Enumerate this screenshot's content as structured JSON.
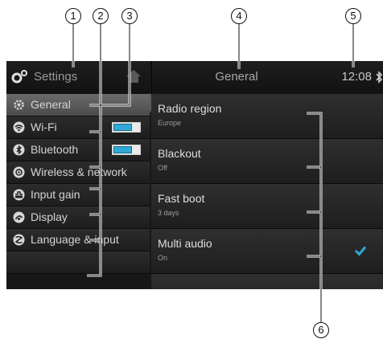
{
  "callouts": [
    "1",
    "2",
    "3",
    "4",
    "5",
    "6"
  ],
  "sidebar": {
    "title": "Settings",
    "items": [
      {
        "label": "General",
        "icon": "gear-icon",
        "active": true
      },
      {
        "label": "Wi-Fi",
        "icon": "wifi-icon",
        "toggle": "on"
      },
      {
        "label": "Bluetooth",
        "icon": "bluetooth-icon",
        "toggle": "on"
      },
      {
        "label": "Wireless & network",
        "icon": "wireless-network-icon"
      },
      {
        "label": "Input gain",
        "icon": "input-gain-icon"
      },
      {
        "label": "Display",
        "icon": "display-icon"
      },
      {
        "label": "Language & input",
        "icon": "language-icon"
      }
    ]
  },
  "header": {
    "title": "General",
    "time": "12:08",
    "status_icon": "bluetooth-icon"
  },
  "settings": [
    {
      "title": "Radio region",
      "value": "Europe"
    },
    {
      "title": "Blackout",
      "value": "Off"
    },
    {
      "title": "Fast boot",
      "value": "3 days"
    },
    {
      "title": "Multi audio",
      "value": "On",
      "checked": true
    }
  ],
  "colors": {
    "accent": "#2fa8d6",
    "background": "#171717",
    "active_item": "#5a5a5a"
  }
}
